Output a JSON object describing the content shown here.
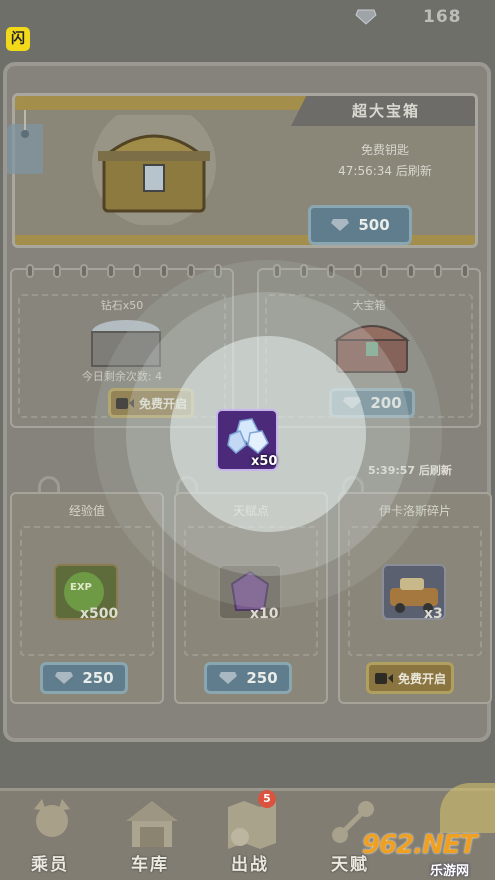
{
  "top": {
    "app_badge": "闪",
    "gem_count": "168",
    "gem_icon": "diamond-icon"
  },
  "big_chest": {
    "title": "超大宝箱",
    "free_key": "免费钥匙",
    "timer": "47:56:34 后刷新",
    "price": "500"
  },
  "mid_left": {
    "title": "钻石x50",
    "remaining": "今日剩余次数: 4",
    "button": "免费开启"
  },
  "mid_right": {
    "title": "大宝箱",
    "price": "200"
  },
  "refresh": "5:39:57 后刷新",
  "small_cards": [
    {
      "title": "经验值",
      "qty": "x500",
      "price": "250"
    },
    {
      "title": "天赋点",
      "qty": "x10",
      "price": "250"
    },
    {
      "title": "伊卡洛斯碎片",
      "qty": "x3",
      "button": "免费开启"
    }
  ],
  "reward": {
    "qty": "x50"
  },
  "nav": [
    {
      "label": "乘员",
      "icon": "crew-icon"
    },
    {
      "label": "车库",
      "icon": "garage-icon"
    },
    {
      "label": "出战",
      "icon": "battle-map-icon",
      "badge": "5"
    },
    {
      "label": "天赋",
      "icon": "talent-icon"
    }
  ],
  "watermark": {
    "top": "962.NET",
    "bottom": "乐游网"
  },
  "colors": {
    "accent_gold": "#a38e4c",
    "button_blue": "#5f7d8c",
    "reward_purple": "#4b2a7a",
    "badge_red": "#d9533e"
  }
}
